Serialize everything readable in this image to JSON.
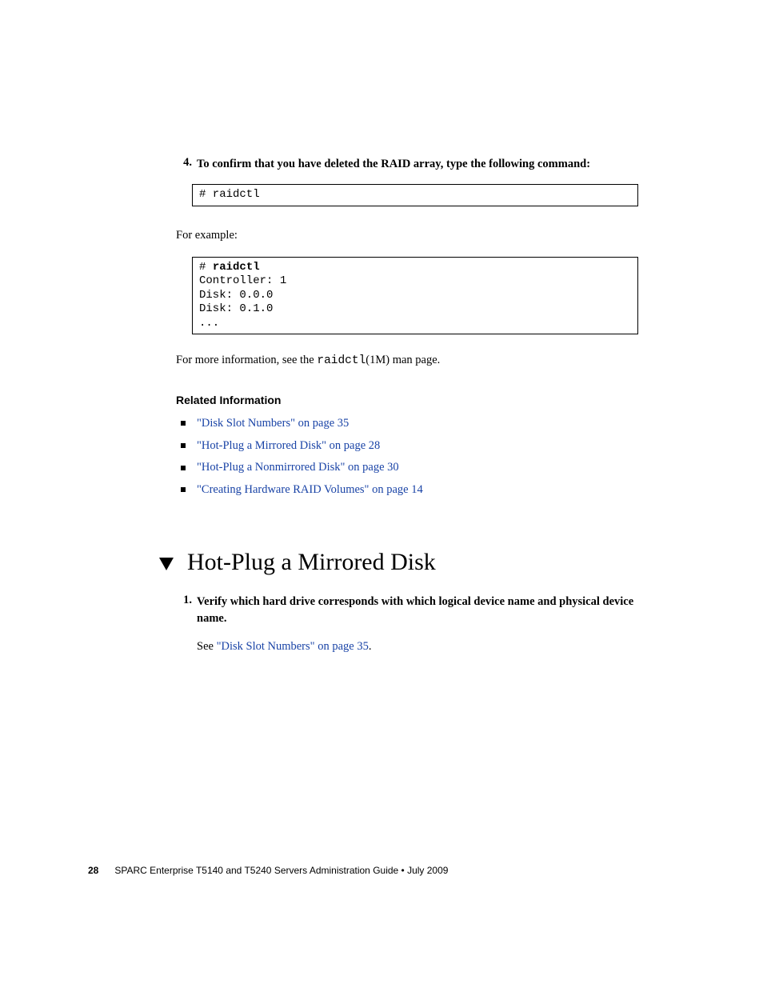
{
  "step4": {
    "num": "4.",
    "text": "To confirm that you have deleted the RAID array, type the following command:"
  },
  "code1": "# raidctl",
  "for_example": "For example:",
  "code2_prompt": "# ",
  "code2_cmd": "raidctl",
  "code2_body": "Controller: 1\nDisk: 0.0.0\nDisk: 0.1.0\n...",
  "moreinfo_pre": "For more information, see the ",
  "moreinfo_cmd": "raidctl",
  "moreinfo_post": "(1M) man page.",
  "related_heading": "Related Information",
  "related_links": [
    "\"Disk Slot Numbers\" on page 35",
    "\"Hot-Plug a Mirrored Disk\" on page 28",
    "\"Hot-Plug a Nonmirrored Disk\" on page 30",
    "\"Creating Hardware RAID Volumes\" on page 14"
  ],
  "section_title": "Hot-Plug a Mirrored Disk",
  "step1": {
    "num": "1.",
    "text": "Verify which hard drive corresponds with which logical device name and physical device name."
  },
  "see_pre": "See ",
  "see_link": "\"Disk Slot Numbers\" on page 35",
  "see_post": ".",
  "footer": {
    "page": "28",
    "title": "SPARC Enterprise T5140 and T5240 Servers Administration Guide • July 2009"
  }
}
